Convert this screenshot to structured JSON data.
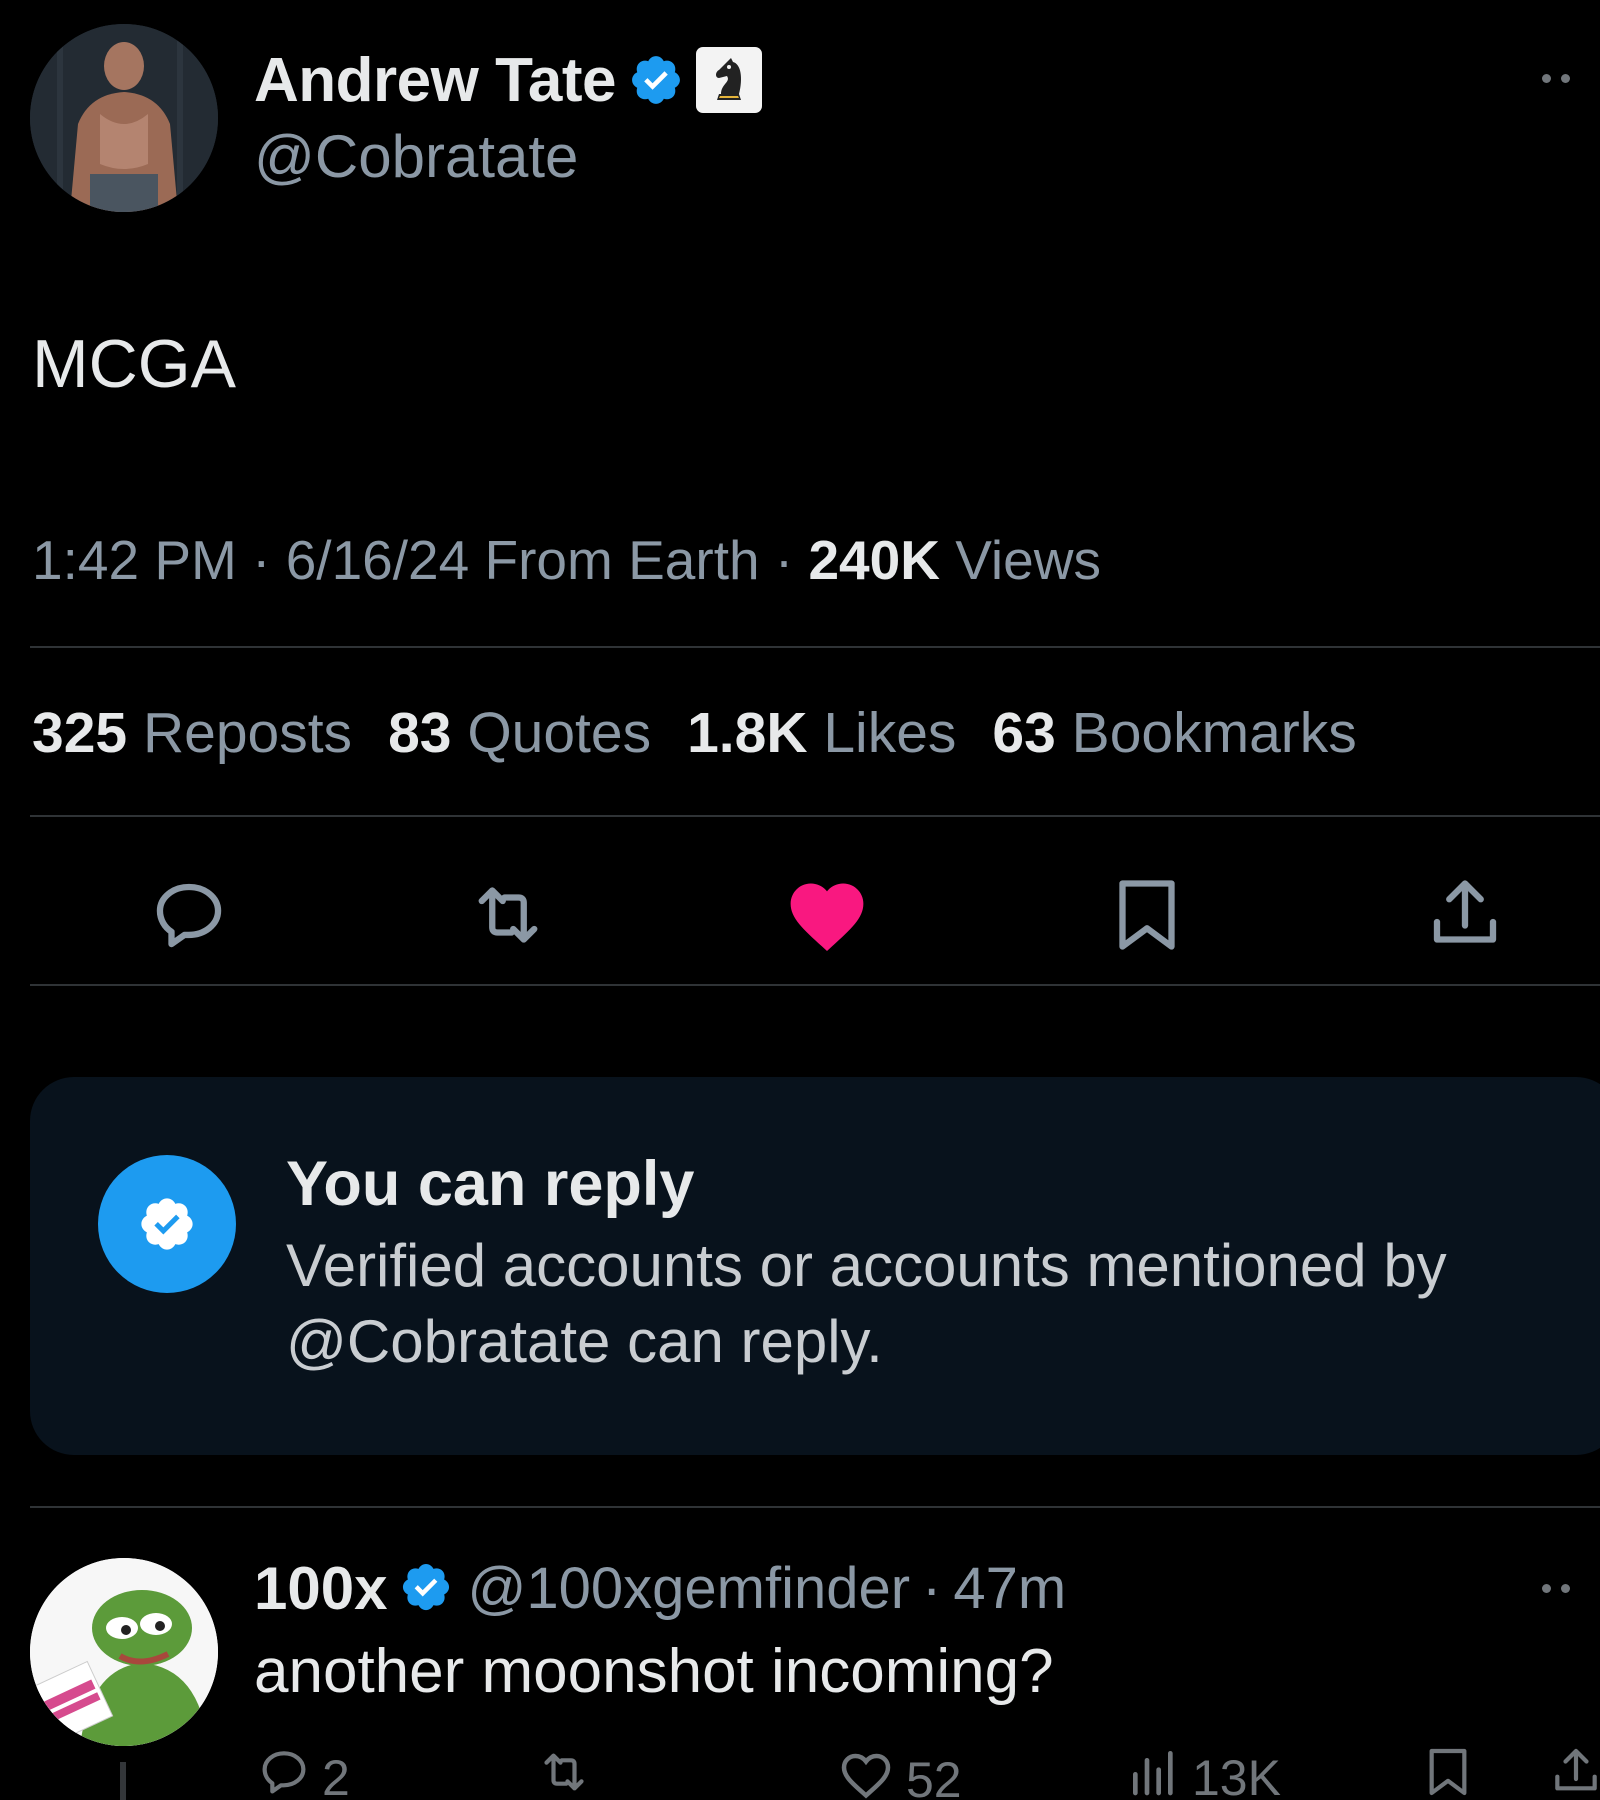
{
  "tweet": {
    "author": {
      "display_name": "Andrew Tate",
      "handle": "@Cobratate",
      "verified": true,
      "affiliate_badge": "chess-knight-icon"
    },
    "text": "MCGA",
    "meta": {
      "time": "1:42 PM",
      "date": "6/16/24",
      "source": "From Earth",
      "views_count": "240K",
      "views_label": "Views"
    },
    "stats": [
      {
        "count": "325",
        "label": "Reposts"
      },
      {
        "count": "83",
        "label": "Quotes"
      },
      {
        "count": "1.8K",
        "label": "Likes"
      },
      {
        "count": "63",
        "label": "Bookmarks"
      }
    ],
    "actions": [
      "reply-icon",
      "repost-icon",
      "like-icon",
      "bookmark-icon",
      "share-icon"
    ],
    "liked": true
  },
  "reply_restriction": {
    "title": "You can reply",
    "description": "Verified accounts or accounts mentioned by @Cobratate can reply."
  },
  "reply": {
    "display_name": "100x",
    "handle": "@100xgemfinder",
    "separator": "·",
    "age": "47m",
    "text": "another moonshot incoming?",
    "reply_count": "2",
    "like_count": "52",
    "views_count": "13K"
  },
  "colors": {
    "background": "#000000",
    "text_primary": "#e7e9ea",
    "text_secondary": "#8b98a5",
    "accent_blue": "#1d9bf0",
    "like_pink": "#f91880",
    "divider": "#2f3336",
    "card_bg": "#08121c"
  }
}
